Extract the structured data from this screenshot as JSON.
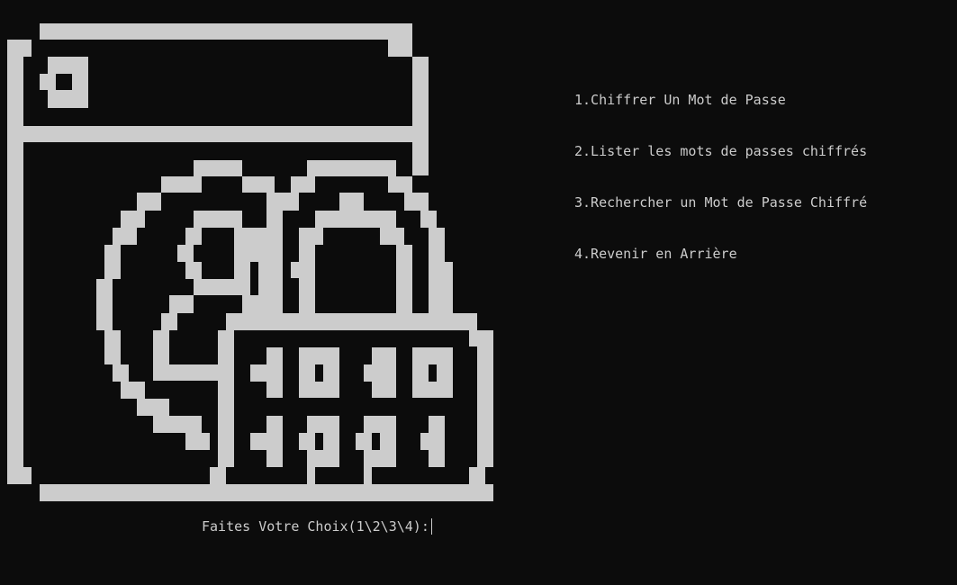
{
  "colors": {
    "background": "#0c0c0c",
    "foreground": "#cccccc"
  },
  "art": {
    "icon": "password-manager-lock-icon"
  },
  "menu": {
    "items": [
      {
        "label": "1.Chiffrer Un Mot de Passe"
      },
      {
        "label": "2.Lister les mots de passes chiffrés"
      },
      {
        "label": "3.Rechercher un Mot de Passe Chiffré"
      },
      {
        "label": "4.Revenir en Arrière"
      }
    ]
  },
  "prompt": {
    "label": "Faites Votre Choix(1\\2\\3\\4):",
    "value": ""
  }
}
